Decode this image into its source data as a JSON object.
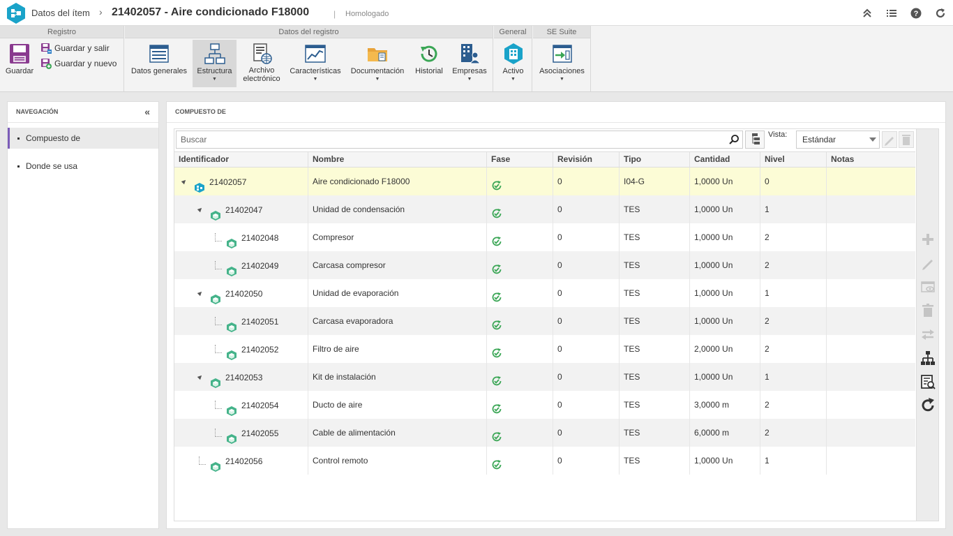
{
  "header": {
    "breadcrumb": "Datos del ítem",
    "separator": "›",
    "record_title": "21402057 - Aire condicionado F18000",
    "divider": "|",
    "status": "Homologado"
  },
  "ribbon": {
    "groups": {
      "registro": "Registro",
      "datos_registro": "Datos del registro",
      "general": "General",
      "se_suite": "SE Suite"
    },
    "guardar": "Guardar",
    "guardar_salir": "Guardar y salir",
    "guardar_nuevo": "Guardar y nuevo",
    "datos_generales": "Datos generales",
    "estructura": "Estructura",
    "archivo_line1": "Archivo",
    "archivo_line2": "electrónico",
    "caracteristicas": "Características",
    "documentacion": "Documentación",
    "historial": "Historial",
    "empresas": "Empresas",
    "activo": "Activo",
    "asociaciones": "Asociaciones"
  },
  "nav": {
    "title": "NAVEGACIÓN",
    "collapse": "«",
    "items": [
      "Compuesto de",
      "Donde se usa"
    ]
  },
  "main": {
    "title": "COMPUESTO DE",
    "search_placeholder": "Buscar",
    "vista_label": "Vista:",
    "vista_value": "Estándar"
  },
  "table": {
    "columns": [
      "Identificador",
      "Nombre",
      "Fase",
      "Revisión",
      "Tipo",
      "Cantidad",
      "Nivel",
      "Notas"
    ],
    "rows": [
      {
        "id": "21402057",
        "nombre": "Aire condicionado F18000",
        "revision": "0",
        "tipo": "I04-G",
        "cantidad": "1,0000 Un",
        "nivel": "0",
        "notas": ""
      },
      {
        "id": "21402047",
        "nombre": "Unidad de condensación",
        "revision": "0",
        "tipo": "TES",
        "cantidad": "1,0000 Un",
        "nivel": "1",
        "notas": ""
      },
      {
        "id": "21402048",
        "nombre": "Compresor",
        "revision": "0",
        "tipo": "TES",
        "cantidad": "1,0000 Un",
        "nivel": "2",
        "notas": ""
      },
      {
        "id": "21402049",
        "nombre": "Carcasa compresor",
        "revision": "0",
        "tipo": "TES",
        "cantidad": "1,0000 Un",
        "nivel": "2",
        "notas": ""
      },
      {
        "id": "21402050",
        "nombre": "Unidad de evaporación",
        "revision": "0",
        "tipo": "TES",
        "cantidad": "1,0000 Un",
        "nivel": "1",
        "notas": ""
      },
      {
        "id": "21402051",
        "nombre": "Carcasa evaporadora",
        "revision": "0",
        "tipo": "TES",
        "cantidad": "1,0000 Un",
        "nivel": "2",
        "notas": ""
      },
      {
        "id": "21402052",
        "nombre": "Filtro de aire",
        "revision": "0",
        "tipo": "TES",
        "cantidad": "2,0000 Un",
        "nivel": "2",
        "notas": ""
      },
      {
        "id": "21402053",
        "nombre": "Kit de instalación",
        "revision": "0",
        "tipo": "TES",
        "cantidad": "1,0000 Un",
        "nivel": "1",
        "notas": ""
      },
      {
        "id": "21402054",
        "nombre": "Ducto de aire",
        "revision": "0",
        "tipo": "TES",
        "cantidad": "3,0000 m",
        "nivel": "2",
        "notas": ""
      },
      {
        "id": "21402055",
        "nombre": "Cable de alimentación",
        "revision": "0",
        "tipo": "TES",
        "cantidad": "6,0000 m",
        "nivel": "2",
        "notas": ""
      },
      {
        "id": "21402056",
        "nombre": "Control remoto",
        "revision": "0",
        "tipo": "TES",
        "cantidad": "1,0000 Un",
        "nivel": "1",
        "notas": ""
      }
    ]
  },
  "colors": {
    "accent_purple": "#7b5cb8",
    "brand_teal": "#1aa3c9",
    "phase_green": "#3aa655",
    "selected_row": "#fcfcd6"
  }
}
